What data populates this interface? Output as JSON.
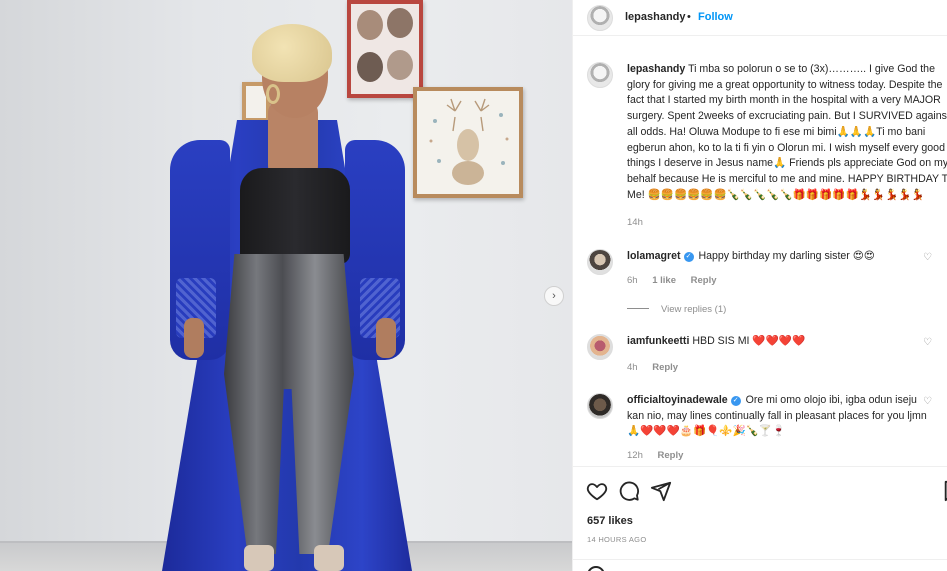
{
  "post": {
    "username": "lepashandy",
    "follow_label": "Follow",
    "separator": "•",
    "caption_text": "Ti mba so polorun o se to (3x)……….. I give God the glory for giving me a great opportunity to witness today. Despite the fact that I started my birth month in the hospital with a very MAJOR surgery. Spent 2weeks of excruciating pain. But I SURVIVED against all odds. Ha! Oluwa Modupe to fi ese mi bimi🙏🙏🙏Ti mo bani egberun ahon, ko to la ti fi yin o Olorun mi. I wish myself every good things I deserve in Jesus name🙏 Friends pls appreciate God on my behalf because He is merciful to me and mine. HAPPY BIRTHDAY TO Me! 🍔🍔🍔🍔🍔🍔🍾🍾🍾🍾🍾🎁🎁🎁🎁🎁💃💃💃💃💃",
    "caption_time": "14h"
  },
  "comments": [
    {
      "username": "lolamagret",
      "verified": true,
      "text": "Happy birthday my darling sister 😍😍",
      "time": "6h",
      "likes": "1 like",
      "reply": "Reply",
      "view_replies": "View replies (1)"
    },
    {
      "username": "iamfunkeetti",
      "verified": false,
      "text": "HBD SIS MI ❤️❤️❤️❤️",
      "time": "4h",
      "reply": "Reply"
    },
    {
      "username": "officialtoyinadewale",
      "verified": true,
      "text": "Ore mi omo olojo ibi, igba odun iseju kan nio, may lines continually fall in pleasant places for you ljmn 🙏❤️❤️❤️🎂🎁🎈⚜️🎉🍾🍸🍷",
      "time": "12h",
      "reply": "Reply"
    }
  ],
  "footer": {
    "likes": "657 likes",
    "time_ago": "14 HOURS AGO"
  },
  "icons": {
    "next": "›",
    "verified": "✓",
    "heart_small": "♡"
  }
}
